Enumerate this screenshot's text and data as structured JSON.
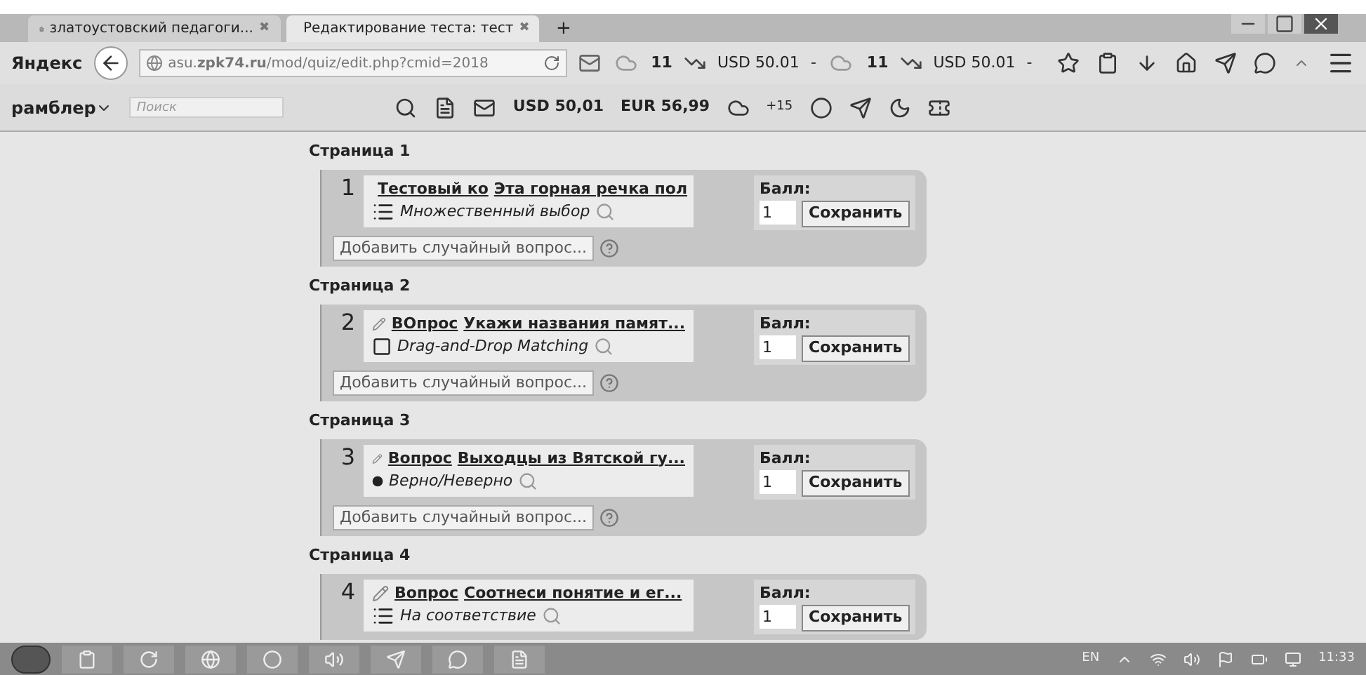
{
  "tabs": [
    {
      "label": "златоустовский педагоги...",
      "selected": false,
      "close": "✖"
    },
    {
      "label": "Редактирование теста: тест",
      "selected": true,
      "close": "✖"
    }
  ],
  "new_tab": "+",
  "navbar": {
    "logo": "Яндекс",
    "url": "asu.**zpk74.ru**/mod/quiz/edit.php?cmid=2018",
    "weather": "11",
    "usd": "USD 50.01",
    "separator": "-",
    "weather_2": "11",
    "usd_2": "USD 50.01",
    "separator_2": "-"
  },
  "rambler_bar": {
    "logo": "рамблер",
    "search": {
      "placeholder": "Поиск"
    },
    "usd": "USD 50,01",
    "eur": "EUR 56,99",
    "temperature": "+15"
  },
  "pages": [
    {
      "title": "Страница 1",
      "number": "1",
      "prefix": "Тестовый ко",
      "name": "Эта горная речка пол",
      "kind": "multichoice",
      "type": "Множественный выбор",
      "score_label": "Балл:",
      "score": "1",
      "save": "Сохранить",
      "add": "Добавить случайный вопрос..."
    },
    {
      "title": "Страница 2",
      "number": "2",
      "prefix": "ВОпрос",
      "name": "Укажи названия памят...",
      "kind": "ddmatch",
      "type": "Drag-and-Drop Matching",
      "score_label": "Балл:",
      "score": "1",
      "save": "Сохранить",
      "add": "Добавить случайный вопрос..."
    },
    {
      "title": "Страница 3",
      "number": "3",
      "prefix": "Вопрос",
      "name": "Выходцы из Вятской гу...",
      "kind": "truefalse",
      "type": "Верно/Неверно",
      "score_label": "Балл:",
      "score": "1",
      "save": "Сохранить",
      "add": "Добавить случайный вопрос..."
    },
    {
      "title": "Страница 4",
      "number": "4",
      "prefix": "Вопрос",
      "name": "Соотнеси понятие и ег...",
      "kind": "match",
      "type": "На соответствие",
      "score_label": "Балл:",
      "score": "1",
      "save": "Сохранить"
    }
  ],
  "taskbar": {
    "language": "EN",
    "time": "11:33"
  }
}
